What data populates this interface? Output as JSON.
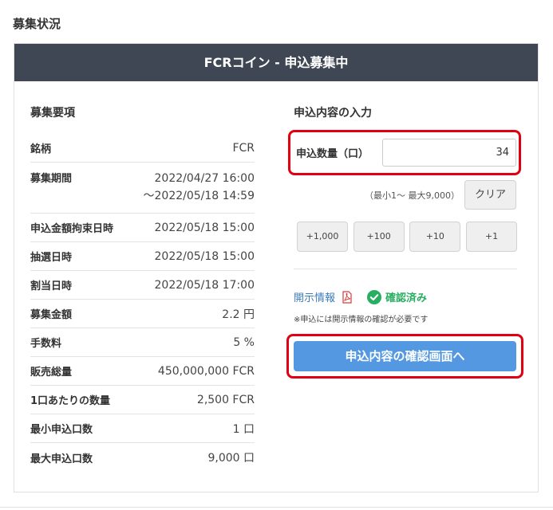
{
  "page_title": "募集状況",
  "card": {
    "header": "FCRコイン - 申込募集中",
    "left": {
      "section_title": "募集要項",
      "rows": [
        {
          "label": "銘柄",
          "value": "FCR"
        },
        {
          "label": "募集期間",
          "value": "2022/04/27 16:00",
          "value2": "〜2022/05/18 14:59"
        },
        {
          "label": "申込金額拘束日時",
          "value": "2022/05/18 15:00"
        },
        {
          "label": "抽選日時",
          "value": "2022/05/18 15:00"
        },
        {
          "label": "割当日時",
          "value": "2022/05/18 17:00"
        },
        {
          "label": "募集金額",
          "value": "2.2 円"
        },
        {
          "label": "手数料",
          "value": "5 %"
        },
        {
          "label": "販売総量",
          "value": "450,000,000 FCR"
        },
        {
          "label": "1口あたりの数量",
          "value": "2,500 FCR"
        },
        {
          "label": "最小申込口数",
          "value": "1 口"
        },
        {
          "label": "最大申込口数",
          "value": "9,000 口"
        }
      ]
    },
    "right": {
      "section_title": "申込内容の入力",
      "quantity_label": "申込数量（口）",
      "quantity_value": "34",
      "range_text": "（最小1〜 最大9,000）",
      "clear_label": "クリア",
      "steps": [
        "+1,000",
        "+100",
        "+10",
        "+1"
      ],
      "disclosure_link": "開示情報",
      "confirmed_label": "確認済み",
      "note": "※申込には開示情報の確認が必要です",
      "submit_label": "申込内容の確認画面へ"
    }
  },
  "colors": {
    "header_bg": "#3e4753",
    "highlight_border": "#e00012",
    "submit_bg": "#5398e0",
    "link": "#3b7cbf",
    "confirmed": "#27ae60"
  },
  "icons": {
    "pdf": "pdf-icon",
    "check": "check-circle-icon"
  }
}
